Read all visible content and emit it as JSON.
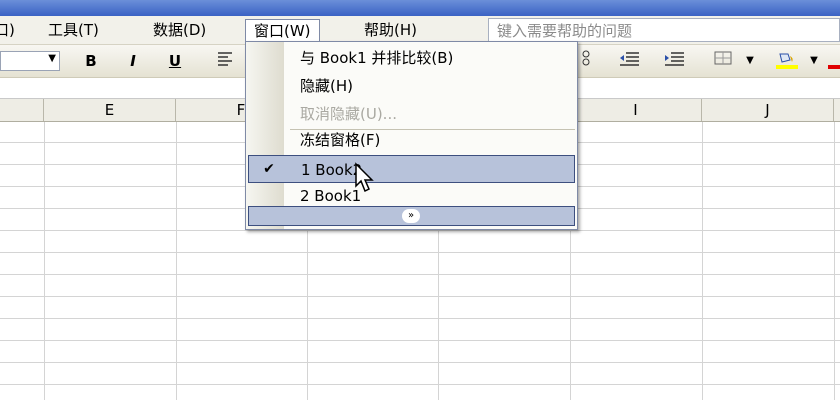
{
  "menubar": {
    "items": [
      {
        "label": "口)"
      },
      {
        "label": "工具(T)"
      },
      {
        "label": "数据(D)"
      },
      {
        "label": "窗口(W)"
      },
      {
        "label": "帮助(H)"
      }
    ],
    "help_placeholder": "键入需要帮助的问题"
  },
  "toolbar": {
    "bold": "B",
    "italic": "I",
    "underline": "U"
  },
  "columns": [
    "E",
    "F",
    "I",
    "J"
  ],
  "window_menu": {
    "items": [
      {
        "label": "与 Book1 并排比较(B)"
      },
      {
        "label": "隐藏(H)"
      },
      {
        "label": "取消隐藏(U)..."
      },
      {
        "label": "冻结窗格(F)"
      },
      {
        "label": "1 Book2"
      },
      {
        "label": "2 Book1"
      }
    ],
    "check_mark": "✔",
    "expand_glyph": "»"
  },
  "colors": {
    "highlight": "#b7c2da",
    "highlight_border": "#3d4f7f"
  }
}
